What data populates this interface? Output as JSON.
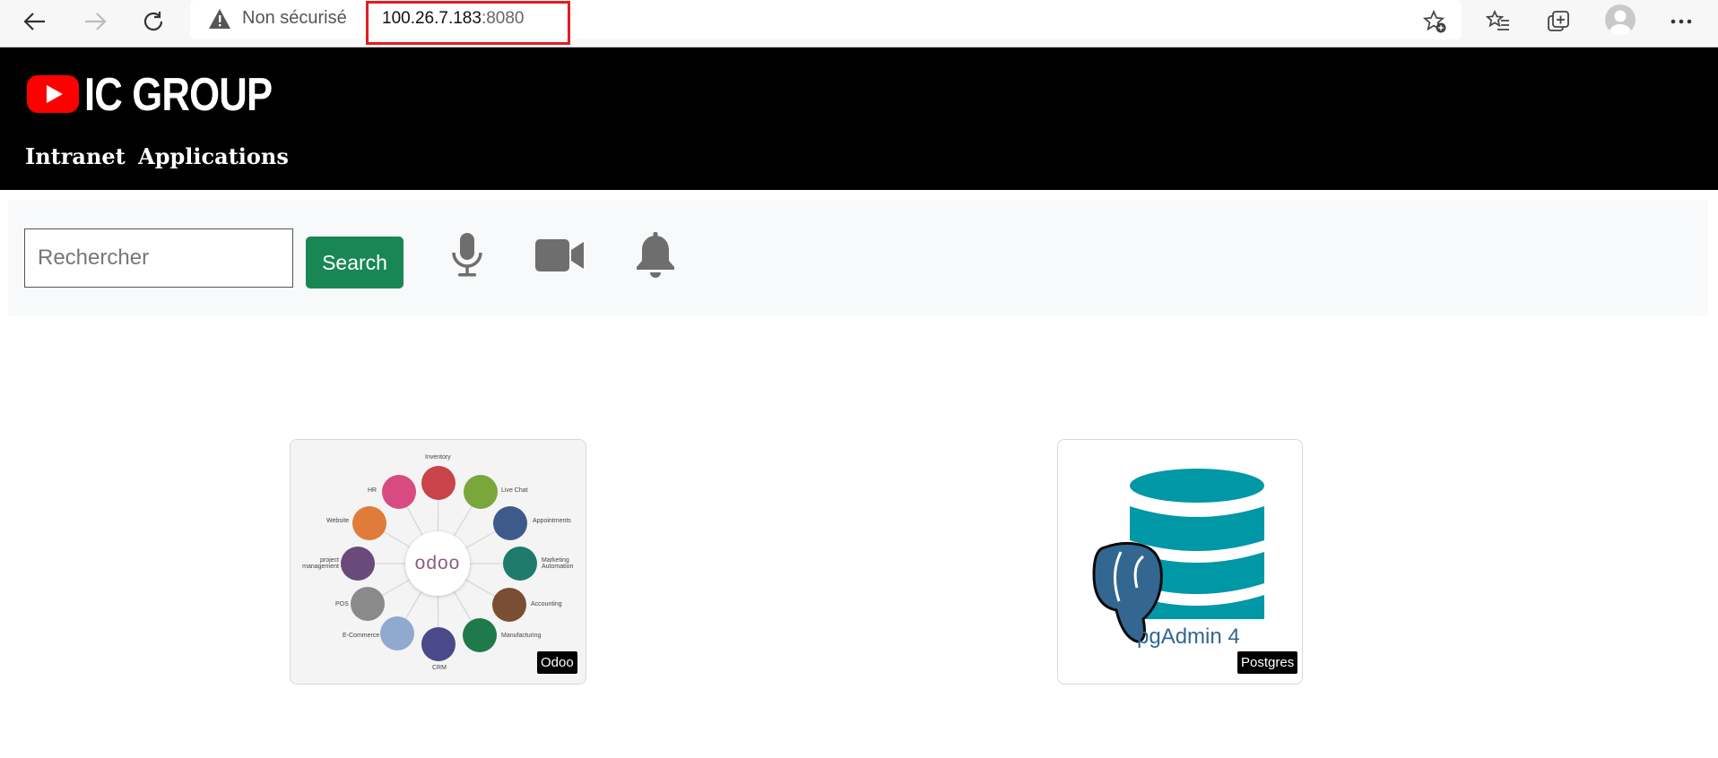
{
  "browser": {
    "security_label": "Non sécurisé",
    "url_host": "100.26.7.183",
    "url_port": ":8080"
  },
  "header": {
    "brand": "IC GROUP",
    "subtitle": "Intranet Applications"
  },
  "search": {
    "placeholder": "Rechercher",
    "button_label": "Search"
  },
  "apps": [
    {
      "label": "Odoo",
      "logo_text": "odoo",
      "modules": [
        "Inventory",
        "Live Chat",
        "Appointments",
        "Marketing Automation",
        "Accounting",
        "Manufacturing",
        "CRM",
        "E-Commerce",
        "POS",
        "project management",
        "Website",
        "HR"
      ]
    },
    {
      "label": "Postgres",
      "logo_text": "pgAdmin 4"
    }
  ],
  "colors": {
    "header_bg": "#000000",
    "search_button": "#198754",
    "url_highlight": "#e51c23",
    "pg_teal": "#0097a7",
    "pg_blue": "#336791"
  }
}
